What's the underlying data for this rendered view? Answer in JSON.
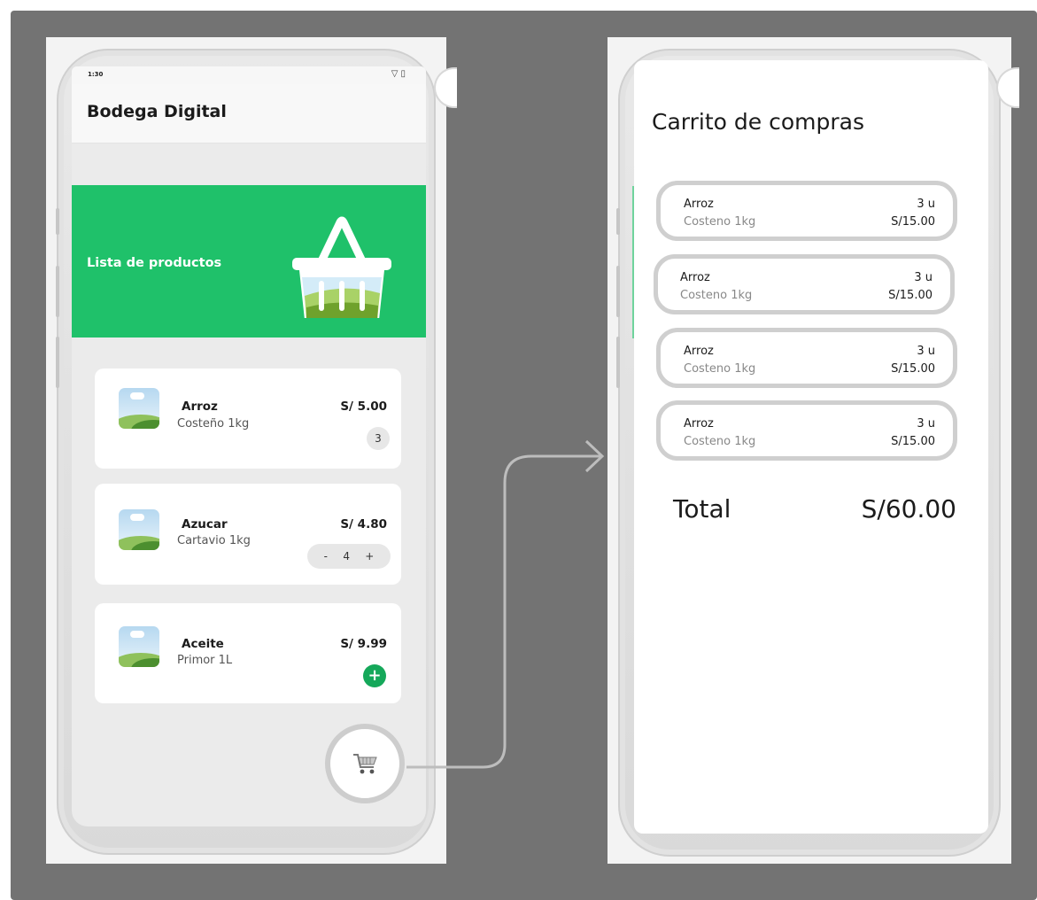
{
  "left_phone": {
    "status_time": "1:30",
    "app_title": "Bodega Digital",
    "banner_title": "Lista de productos",
    "products": [
      {
        "name": "Arroz",
        "desc": "Costeño 1kg",
        "price": "S/ 5.00",
        "qty": "3"
      },
      {
        "name": "Azucar",
        "desc": "Cartavio 1kg",
        "price": "S/ 4.80",
        "stepper": {
          "minus": "-",
          "qty": "4",
          "plus": "+"
        }
      },
      {
        "name": "Aceite",
        "desc": "Primor 1L",
        "price": "S/ 9.99",
        "add": "+"
      }
    ],
    "cart_icon": "cart-icon"
  },
  "right_phone": {
    "title": "Carrito de compras",
    "items": [
      {
        "name": "Arroz",
        "desc": "Costeno 1kg",
        "qty": "3 u",
        "price": "S/15.00"
      },
      {
        "name": "Arroz",
        "desc": "Costeno 1kg",
        "qty": "3 u",
        "price": "S/15.00"
      },
      {
        "name": "Arroz",
        "desc": "Costeno 1kg",
        "qty": "3 u",
        "price": "S/15.00"
      },
      {
        "name": "Arroz",
        "desc": "Costeno 1kg",
        "qty": "3 u",
        "price": "S/15.00"
      }
    ],
    "total_label": "Total",
    "total_value": "S/60.00"
  },
  "colors": {
    "background": "#737373",
    "banner_green": "#1fc16a",
    "add_button_green": "#15a85a",
    "border_gray": "#cfcfcf"
  }
}
